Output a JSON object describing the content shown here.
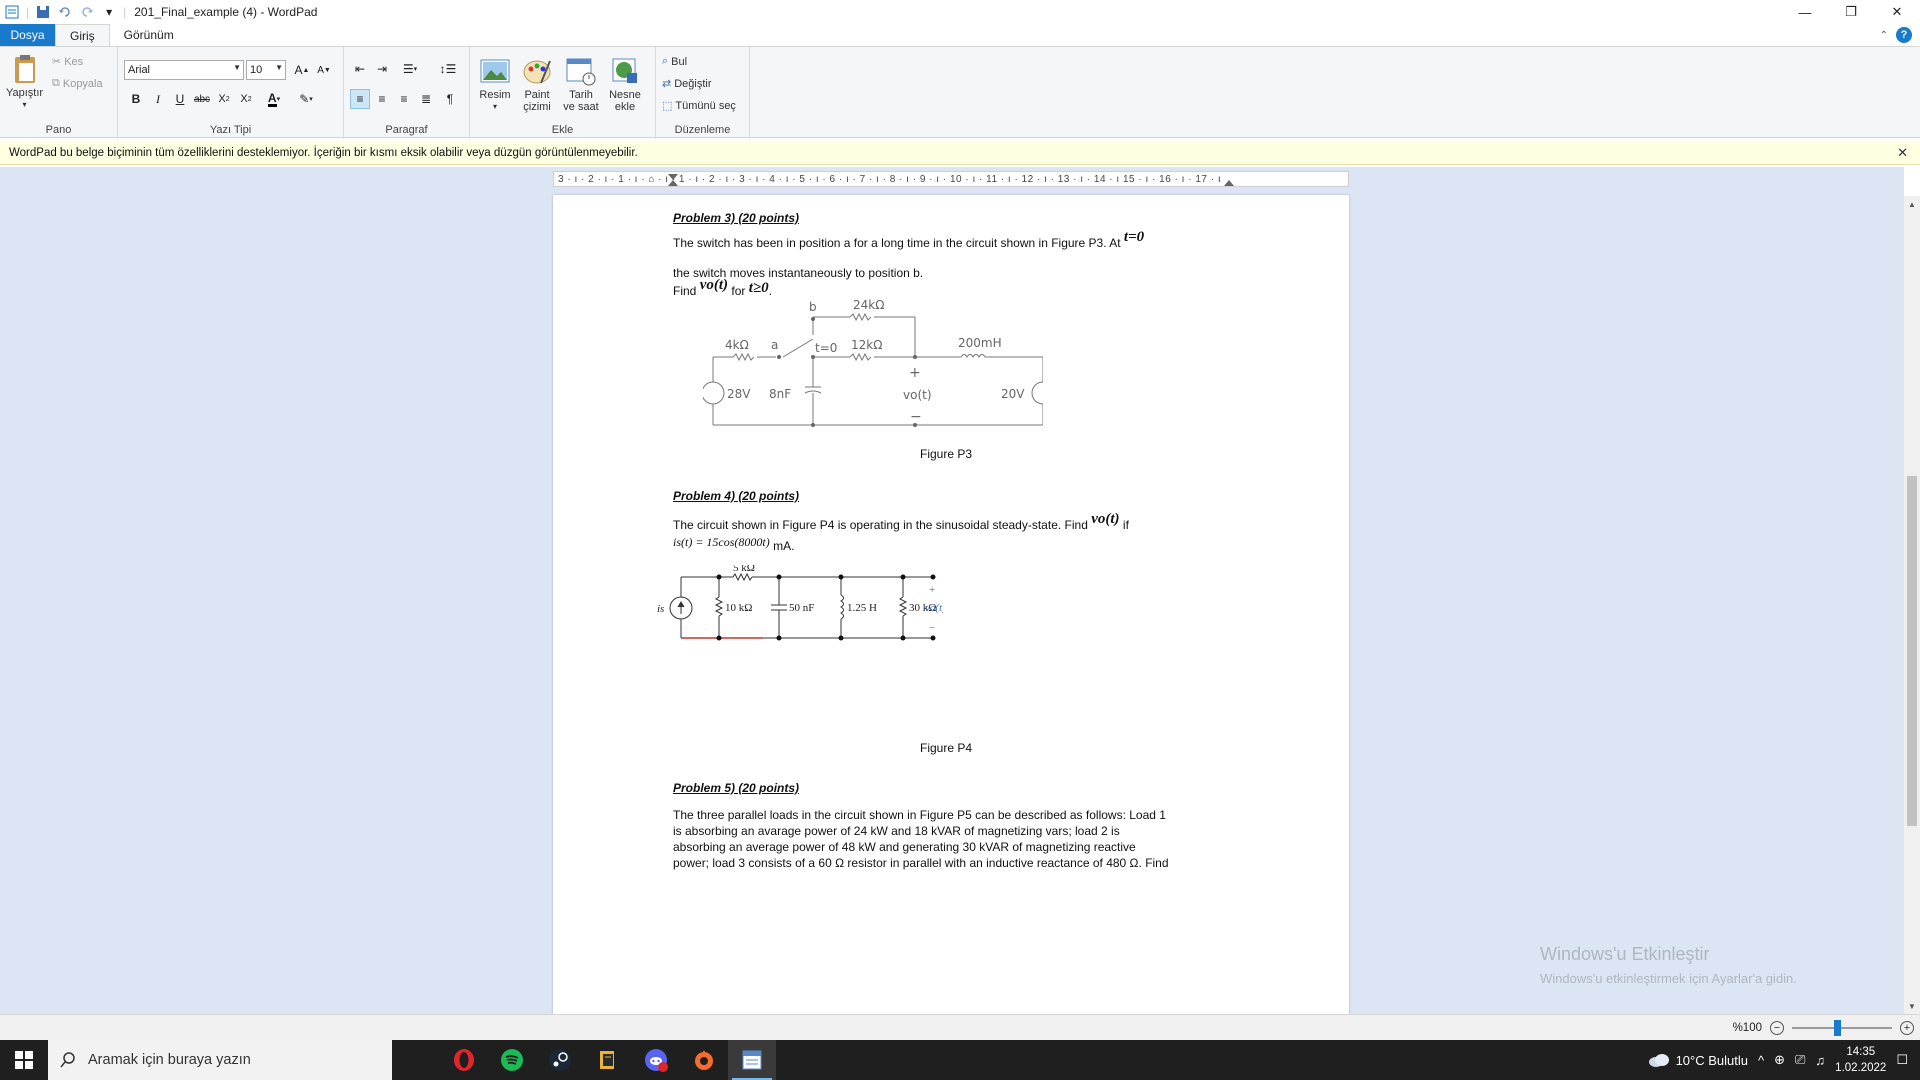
{
  "window": {
    "title": "201_Final_example (4) - WordPad",
    "qat_dropdown": "▾",
    "minimize": "—",
    "restore": "❐",
    "close": "✕"
  },
  "tabs": [
    {
      "label": "Dosya"
    },
    {
      "label": "Giriş"
    },
    {
      "label": "Görünüm"
    }
  ],
  "help_label": "?",
  "ribbon": {
    "pano": {
      "label": "Pano",
      "paste": "Yapıştır",
      "cut": "Kes",
      "copy": "Kopyala"
    },
    "font": {
      "label": "Yazı Tipi",
      "family": "Arial",
      "size": "10"
    },
    "paragraph": {
      "label": "Paragraf"
    },
    "insert": {
      "label": "Ekle",
      "picture": "Resim",
      "paint": "Paint\nçizimi",
      "paint_l1": "Paint",
      "paint_l2": "çizimi",
      "datetime_l1": "Tarih",
      "datetime_l2": "ve saat",
      "object_l1": "Nesne",
      "object_l2": "ekle"
    },
    "editing": {
      "label": "Düzenleme",
      "find": "Bul",
      "replace": "Değiştir",
      "select_all": "Tümünü seç"
    }
  },
  "infobar": {
    "message": "WordPad bu belge biçiminin tüm özelliklerini desteklemiyor. İçeriğin bir kısmı eksik olabilir veya düzgün görüntülenmeyebilir.",
    "close": "✕"
  },
  "ruler": {
    "text": "3 · ı · 2 · ı · 1 · ı · ⌂ · ı · 1 · ı · 2 · ı · 3 · ı · 4 · ı · 5 · ı · 6 · ı · 7 · ı · 8 · ı · 9 · ı · 10 · ı · 11 · ı · 12 · ı · 13 · ı · 14 · ı 15 · ı · 16 · ı · 17 · ı"
  },
  "document": {
    "p3": {
      "title": "Problem 3) (20 points)",
      "line1": "The switch has been in position a for a long time in the circuit shown in Figure P3. At",
      "t0": "t=0",
      "line2": "the switch moves instantaneously to position b.",
      "find": "Find",
      "vo": "vo(t)",
      "for": "for",
      "tge0": "t≥0",
      "period": ".",
      "caption": "Figure P3",
      "labels": {
        "r1": "4kΩ",
        "a": "a",
        "b": "b",
        "sw": "t=0",
        "r2": "24kΩ",
        "r3": "12kΩ",
        "l": "200mH",
        "src1": "28V",
        "cap": "8nF",
        "vout": "vo(t)",
        "src2": "20V",
        "plus": "+",
        "minus": "−"
      }
    },
    "p4": {
      "title": "Problem 4) (20 points)",
      "line1": "The circuit shown in Figure P4 is operating in the sinusoidal steady-state. Find",
      "vo": "vo(t)",
      "if": "if",
      "is_eq": "is(t) = 15cos(8000t)",
      "ma": "mA.",
      "caption": "Figure P4",
      "labels": {
        "r5k": "5 kΩ",
        "is": "is",
        "r10k": "10 kΩ",
        "c": "50 nF",
        "l": "1.25 H",
        "r30k": "30 kΩ",
        "vo": "vo(t)",
        "plus": "+",
        "minus": "−"
      }
    },
    "p5": {
      "title": "Problem 5) (20 points)",
      "lines": [
        "The three parallel loads in the circuit shown in Figure P5 can be described as follows: Load 1",
        "is absorbing an avarage power of 24 kW and 18 kVAR of magnetizing vars; load 2 is",
        "absorbing an average power of 48 kW and generating 30 kVAR of magnetizing reactive",
        "power; load 3 consists of a 60 Ω resistor in parallel with an inductive reactance of 480 Ω. Find"
      ]
    }
  },
  "watermark": {
    "line1": "Windows'u Etkinleştir",
    "line2": "Windows'u etkinleştirmek için Ayarlar'a gidin."
  },
  "statusbar": {
    "zoom": "%100",
    "zoom_out": "−",
    "zoom_in": "+",
    "zoom_level": 1.0
  },
  "taskbar": {
    "search_placeholder": "Aramak için buraya yazın",
    "weather": "10°C  Bulutlu",
    "time": "14:35",
    "date": "1.02.2022",
    "apps": [
      "opera-icon",
      "spotify-icon",
      "steam-icon",
      "folder-icon",
      "discord-icon",
      "origin-icon",
      "wordpad-icon"
    ]
  },
  "colors": {
    "accent": "#1979ca",
    "infobar_bg": "#ffffe1",
    "workspace_bg": "#dbe5f3",
    "taskbar_bg": "#1f1f1f"
  }
}
